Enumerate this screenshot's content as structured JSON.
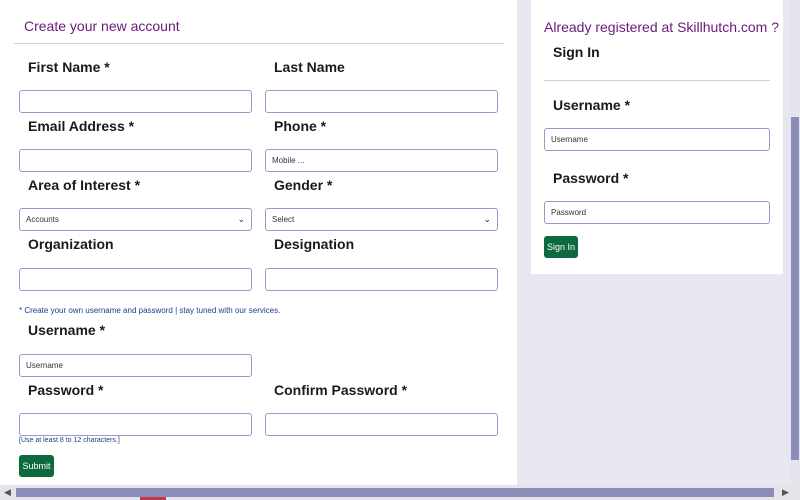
{
  "register": {
    "title": "Create your new account",
    "first_name_label": "First Name *",
    "last_name_label": "Last Name",
    "email_label": "Email Address *",
    "phone_label": "Phone *",
    "phone_placeholder": "Mobile ...",
    "interest_label": "Area of Interest *",
    "interest_value": "Accounts",
    "gender_label": "Gender *",
    "gender_value": "Select",
    "organization_label": "Organization",
    "designation_label": "Designation",
    "note": "* Create your own username and password | stay tuned with our services.",
    "username_label": "Username *",
    "username_placeholder": "Username",
    "password_label": "Password *",
    "confirm_password_label": "Confirm Password *",
    "password_hint": "[Use at least 8 to 12 characters.]",
    "submit_label": "Submit"
  },
  "login": {
    "title": "Already registered at Skillhutch.com ?",
    "heading": "Sign In",
    "username_label": "Username *",
    "username_placeholder": "Username",
    "password_label": "Password *",
    "password_placeholder": "Password",
    "button_label": "Sign In"
  },
  "colors": {
    "accent_title": "#6a1b7a",
    "button": "#0d6a3e",
    "scrollbar": "#8c8cb9"
  }
}
